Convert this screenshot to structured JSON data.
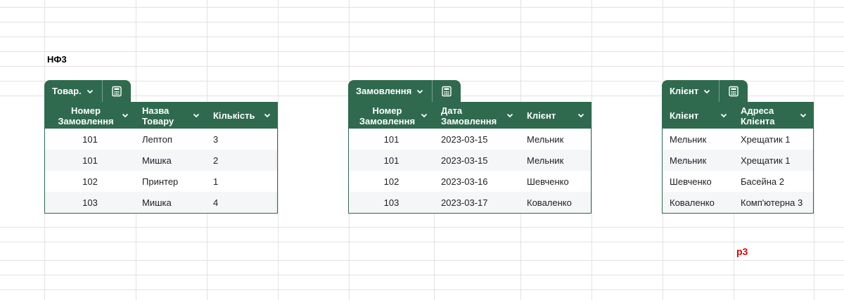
{
  "sheet": {
    "title": "НФ3",
    "marker": "р3"
  },
  "tables": [
    {
      "name": "Товар.",
      "columns": [
        "Номер Замовлення",
        "Назва Товару",
        "Кількість"
      ],
      "rows": [
        [
          "101",
          "Лептоп",
          "3"
        ],
        [
          "101",
          "Мишка",
          "2"
        ],
        [
          "102",
          "Принтер",
          "1"
        ],
        [
          "103",
          "Мишка",
          "4"
        ]
      ]
    },
    {
      "name": "Замовлення",
      "columns": [
        "Номер Замовлення",
        "Дата Замовлення",
        "Клієнт"
      ],
      "rows": [
        [
          "101",
          "2023-03-15",
          "Мельник"
        ],
        [
          "101",
          "2023-03-15",
          "Мельник"
        ],
        [
          "102",
          "2023-03-16",
          "Шевченко"
        ],
        [
          "103",
          "2023-03-17",
          "Коваленко"
        ]
      ]
    },
    {
      "name": "Клієнт",
      "columns": [
        "Клієнт",
        "Адреса Клієнта"
      ],
      "rows": [
        [
          "Мельник",
          "Хрещатик 1"
        ],
        [
          "Мельник",
          "Хрещатик 1"
        ],
        [
          "Шевченко",
          "Басейна 2"
        ],
        [
          "Коваленко",
          "Комп'ютерна 3"
        ]
      ]
    }
  ],
  "colors": {
    "table_header": "#2f6a4f",
    "row_alt": "#f4f6f8",
    "marker": "#e00000",
    "gridline": "#e2e2e2"
  },
  "icons": {
    "dropdown": "chevron-down-icon",
    "calc": "calculator-icon"
  }
}
